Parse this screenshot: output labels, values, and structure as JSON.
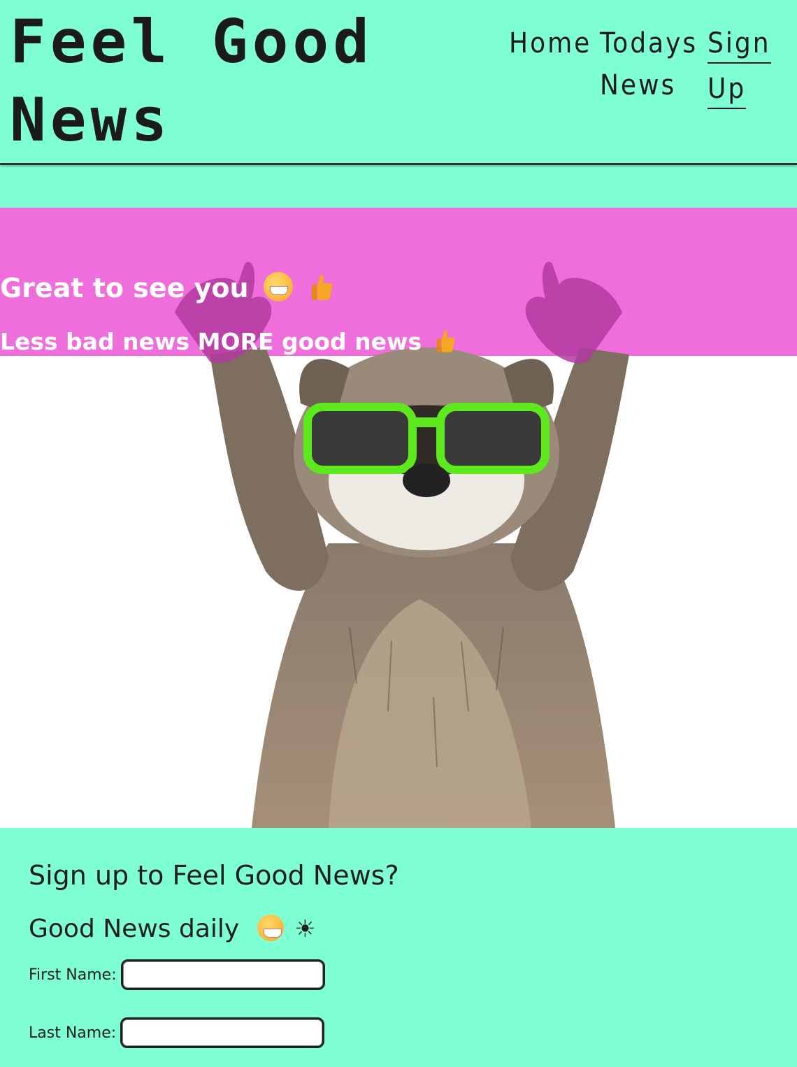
{
  "header": {
    "logo_line1": "Feel Good",
    "logo_line2": "News",
    "nav": {
      "home": "Home",
      "todays_line1": "Todays",
      "todays_line2": "News",
      "signup_line1": "Sign",
      "signup_line2": "Up"
    }
  },
  "hero": {
    "title": "Great to see you",
    "subtitle": "Less bad news MORE good news",
    "band_color": "#f06ddc",
    "text_color": "#ffffff",
    "image_icon": "raccoon-with-sunglasses"
  },
  "signup": {
    "heading": "Sign up to Feel Good News?",
    "subheading": "Good News daily",
    "sun_icon": "☀",
    "first_name_label": "First Name:",
    "first_name_value": "",
    "last_name_label": "Last Name:",
    "last_name_value": ""
  },
  "colors": {
    "background": "#7fffd4",
    "accent": "#f06ddc",
    "text": "#1e1e1e"
  }
}
